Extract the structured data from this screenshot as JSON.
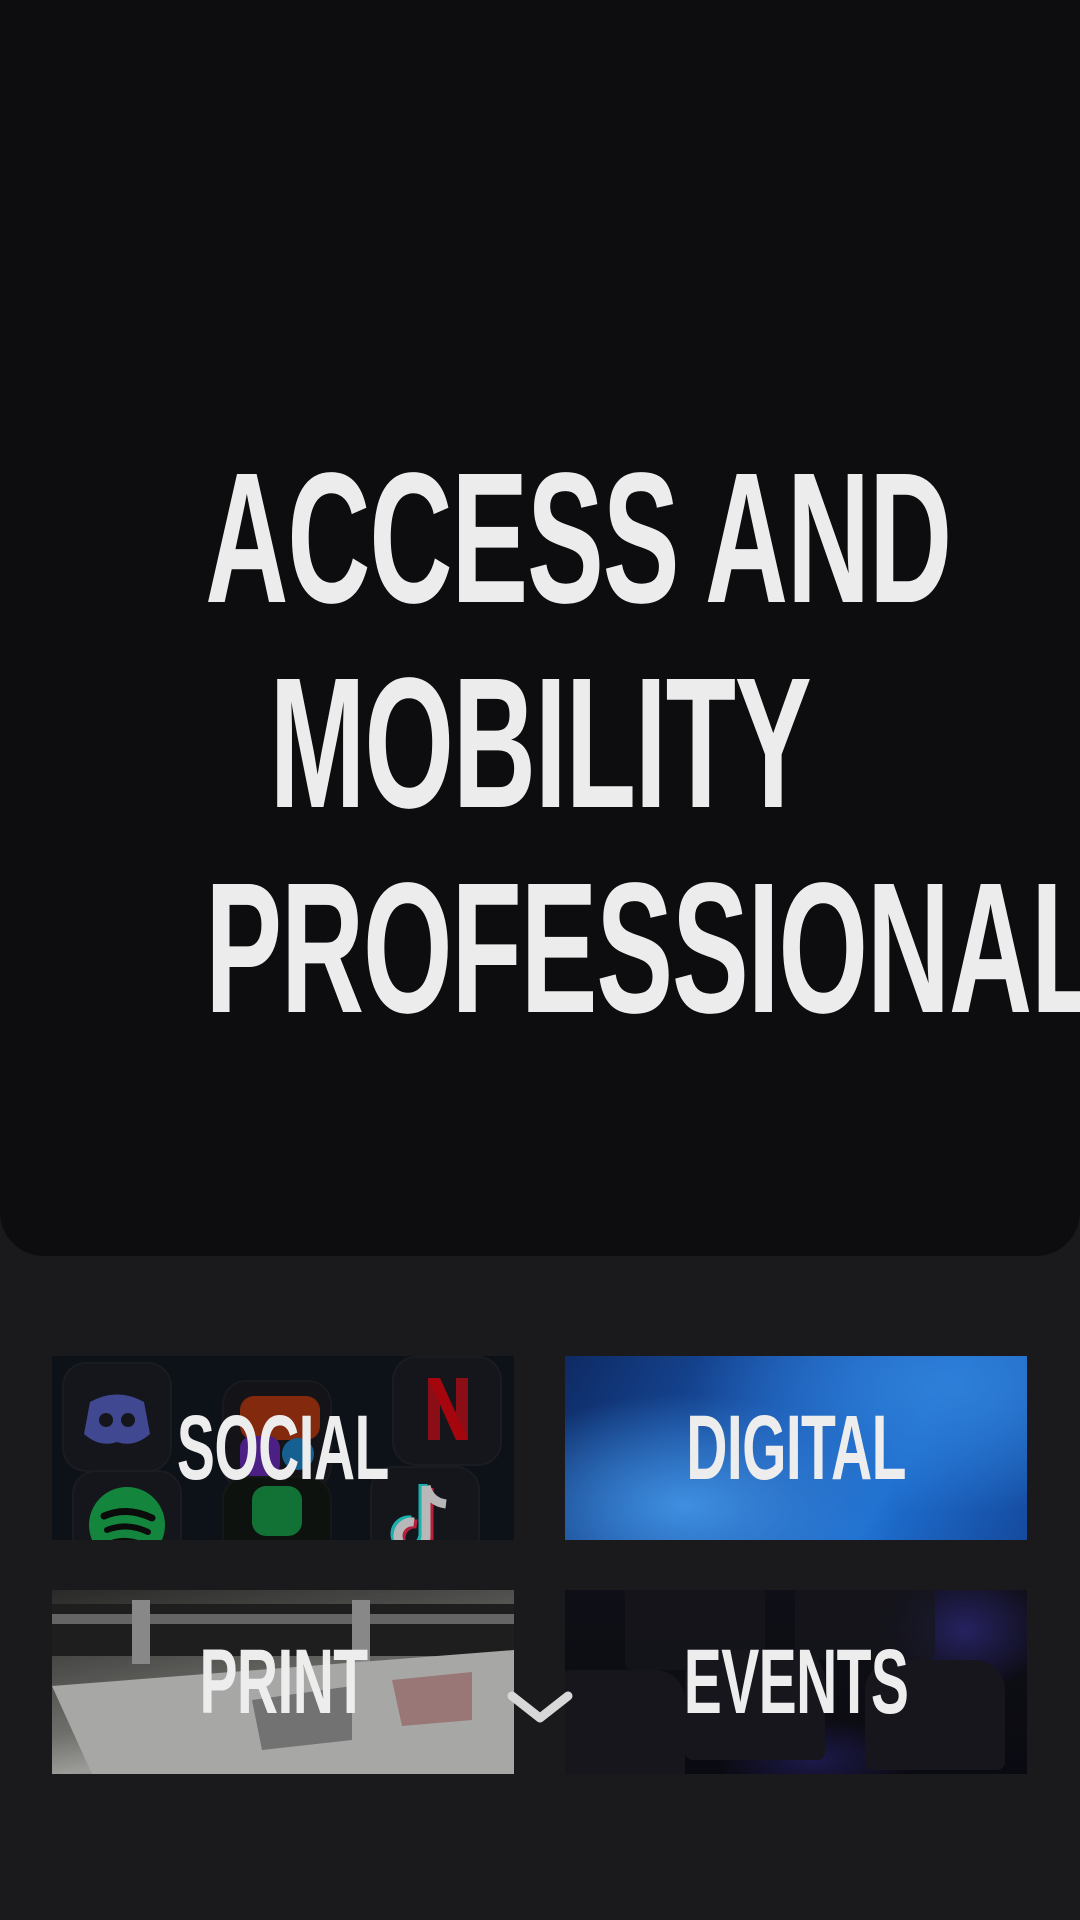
{
  "hero": {
    "title_lines": [
      "ACCESS AND",
      "MOBILITY",
      "PROFESSIONAL"
    ]
  },
  "tiles": [
    {
      "label": "SOCIAL"
    },
    {
      "label": "DIGITAL"
    },
    {
      "label": "PRINT"
    },
    {
      "label": "EVENTS"
    }
  ],
  "icons": {
    "scroll": "chevron-down-icon",
    "social_apps": [
      "discord-icon",
      "netflix-icon",
      "office-icon",
      "spotify-icon",
      "tiktok-icon"
    ]
  },
  "colors": {
    "page_background": "#1a1a1c",
    "hero_background": "#0d0d10",
    "text": "#ececec"
  }
}
